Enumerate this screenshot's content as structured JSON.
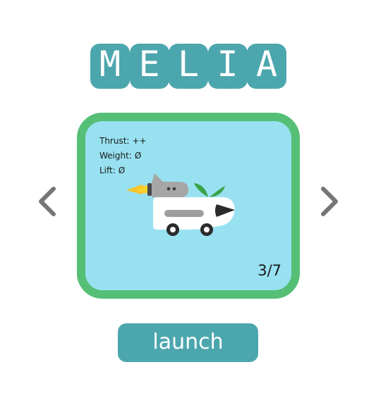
{
  "title": {
    "letters": [
      "M",
      "E",
      "L",
      "I",
      "A"
    ]
  },
  "navigation": {
    "prev_icon": "chevron-left-icon",
    "next_icon": "chevron-right-icon"
  },
  "card": {
    "stats": [
      {
        "label": "Thrust:",
        "value": "++"
      },
      {
        "label": "Weight:",
        "value": "Ø"
      },
      {
        "label": "Lift:",
        "value": "Ø"
      }
    ],
    "counter": "3/7",
    "vehicle_icon": "rocket-cart-icon"
  },
  "launch": {
    "label": "launch"
  },
  "colors": {
    "title_tile": "#4ca6ad",
    "card_border": "#55bf76",
    "card_background": "#98e1f0",
    "button": "#4ca6ad",
    "arrow": "#757575"
  }
}
